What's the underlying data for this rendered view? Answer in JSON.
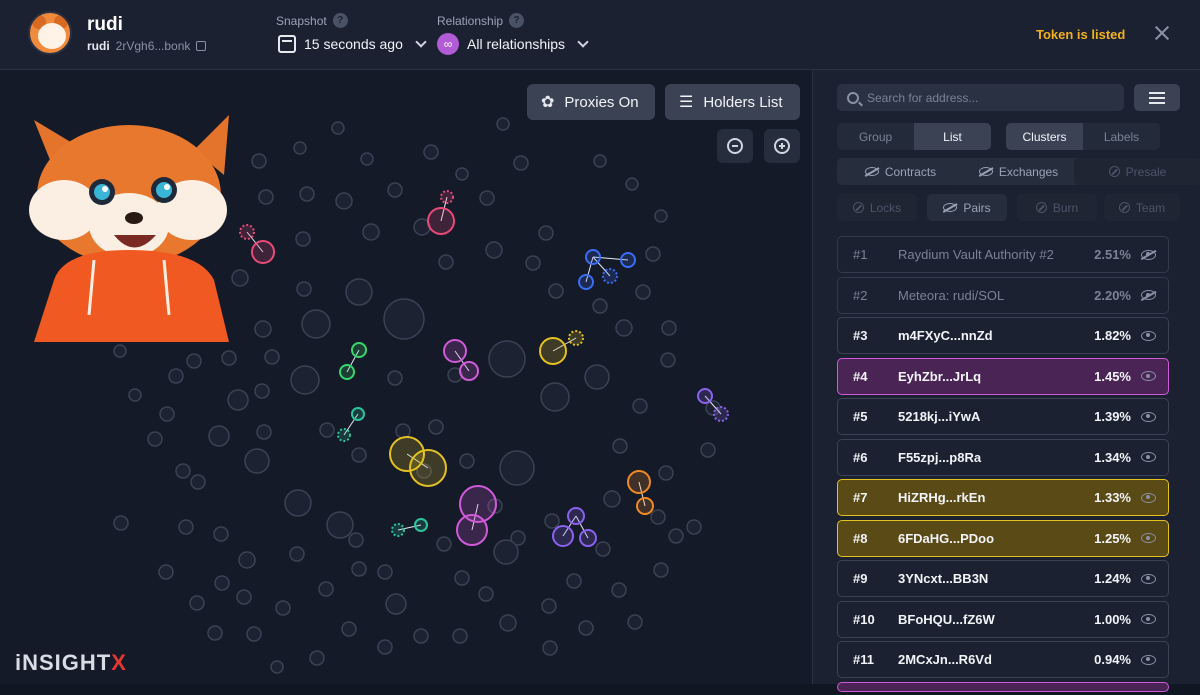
{
  "header": {
    "token_name": "rudi",
    "token_symbol": "rudi",
    "token_address": "2rVgh6...bonk",
    "snapshot_label": "Snapshot",
    "snapshot_value": "15 seconds ago",
    "relationship_label": "Relationship",
    "relationship_value": "All relationships",
    "status": "Token is listed",
    "status_color": "#f2b01e"
  },
  "canvas": {
    "proxies_button": "Proxies On",
    "holders_button": "Holders List",
    "brand_prefix": "iNSIGHT",
    "brand_suffix": "X"
  },
  "panel": {
    "search_placeholder": "Search for address...",
    "view_tabs": [
      {
        "label": "Group",
        "active": false
      },
      {
        "label": "List",
        "active": true
      }
    ],
    "mode_tabs": [
      {
        "label": "Clusters",
        "active": true
      },
      {
        "label": "Labels",
        "active": false
      }
    ],
    "filters": [
      {
        "label": "Contracts",
        "icon": "eye-off-icon",
        "enabled": true
      },
      {
        "label": "Exchanges",
        "icon": "eye-off-icon",
        "enabled": true
      },
      {
        "label": "Presale",
        "icon": "ban-icon",
        "enabled": false
      },
      {
        "label": "Locks",
        "icon": "ban-icon",
        "enabled": false
      },
      {
        "label": "Pairs",
        "icon": "eye-off-icon",
        "enabled": true
      },
      {
        "label": "Burn",
        "icon": "ban-icon",
        "enabled": false
      },
      {
        "label": "Team",
        "icon": "ban-icon",
        "enabled": false
      }
    ],
    "holders": [
      {
        "rank": "#1",
        "name": "Raydium Vault Authority #2",
        "pct": "2.51%",
        "style": "dim",
        "hidden": true
      },
      {
        "rank": "#2",
        "name": "Meteora: rudi/SOL",
        "pct": "2.20%",
        "style": "dim",
        "hidden": true
      },
      {
        "rank": "#3",
        "name": "m4FXyC...nnZd",
        "pct": "1.82%",
        "style": "",
        "hidden": false
      },
      {
        "rank": "#4",
        "name": "EyhZbr...JrLq",
        "pct": "1.45%",
        "style": "purple",
        "hidden": false
      },
      {
        "rank": "#5",
        "name": "5218kj...iYwA",
        "pct": "1.39%",
        "style": "",
        "hidden": false
      },
      {
        "rank": "#6",
        "name": "F55zpj...p8Ra",
        "pct": "1.34%",
        "style": "",
        "hidden": false
      },
      {
        "rank": "#7",
        "name": "HiZRHg...rkEn",
        "pct": "1.33%",
        "style": "gold",
        "hidden": false
      },
      {
        "rank": "#8",
        "name": "6FDaHG...PDoo",
        "pct": "1.25%",
        "style": "gold",
        "hidden": false
      },
      {
        "rank": "#9",
        "name": "3YNcxt...BB3N",
        "pct": "1.24%",
        "style": "",
        "hidden": false
      },
      {
        "rank": "#10",
        "name": "BFoHQU...fZ6W",
        "pct": "1.00%",
        "style": "",
        "hidden": false
      },
      {
        "rank": "#11",
        "name": "2MCxJn...R6Vd",
        "pct": "0.94%",
        "style": "",
        "hidden": false
      }
    ]
  },
  "colors": {
    "purple": "#d15ad9",
    "gold": "#e5c21f",
    "pink": "#e94a7a",
    "blue": "#3b6ef5",
    "green": "#38d66b",
    "teal": "#2ec49a",
    "violet": "#8a62ef",
    "orange": "#f08a22"
  }
}
